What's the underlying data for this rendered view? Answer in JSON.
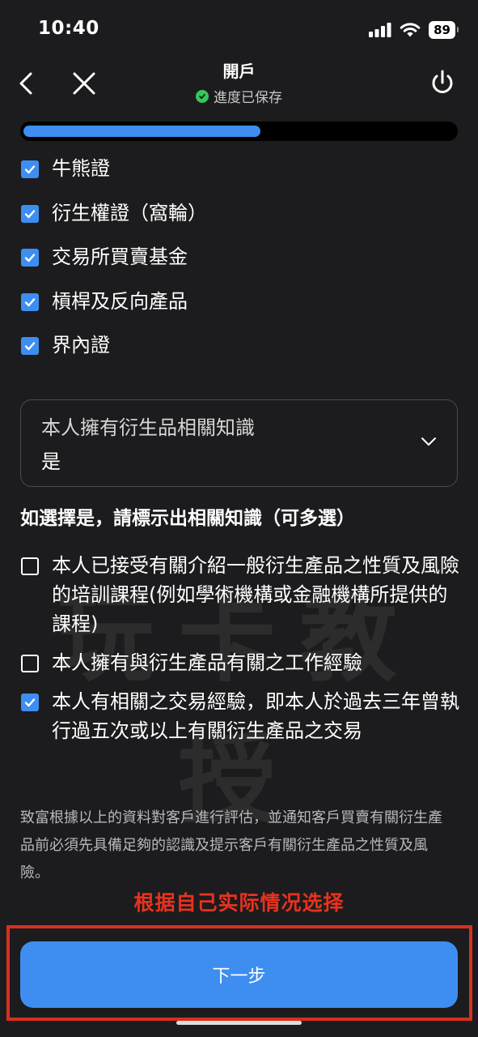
{
  "status_bar": {
    "time": "10:40",
    "battery": "89"
  },
  "nav": {
    "title": "開戶",
    "subtitle": "進度已保存"
  },
  "progress": {
    "fraction": 0.55
  },
  "products": [
    {
      "label": "牛熊證",
      "checked": true
    },
    {
      "label": "衍生權證（窩輪）",
      "checked": true
    },
    {
      "label": "交易所買賣基金",
      "checked": true
    },
    {
      "label": "槓桿及反向產品",
      "checked": true
    },
    {
      "label": "界內證",
      "checked": true
    }
  ],
  "knowledge_select": {
    "label": "本人擁有衍生品相關知識",
    "value": "是"
  },
  "section_title": "如選擇是，請標示出相關知識（可多選）",
  "knowledge_options": [
    {
      "label": "本人已接受有關介紹一般衍生產品之性質及風險的培訓課程(例如學術機構或金融機構所提供的課程)",
      "checked": false
    },
    {
      "label": "本人擁有與衍生產品有關之工作經驗",
      "checked": false
    },
    {
      "label": "本人有相關之交易經驗，即本人於過去三年曾執行過五次或以上有關衍生產品之交易",
      "checked": true
    }
  ],
  "disclaimer": "致富根據以上的資料對客戶進行評估，並通知客戶買賣有關衍生產品前必須先具備足夠的認識及提示客戶有關衍生產品之性質及風險。",
  "annotation": "根据自己实际情况选择",
  "next_button": "下一步",
  "watermark": "玩卡教授",
  "colors": {
    "accent": "#3d8ef0",
    "annotation": "#e8321f",
    "saved": "#34c759"
  }
}
